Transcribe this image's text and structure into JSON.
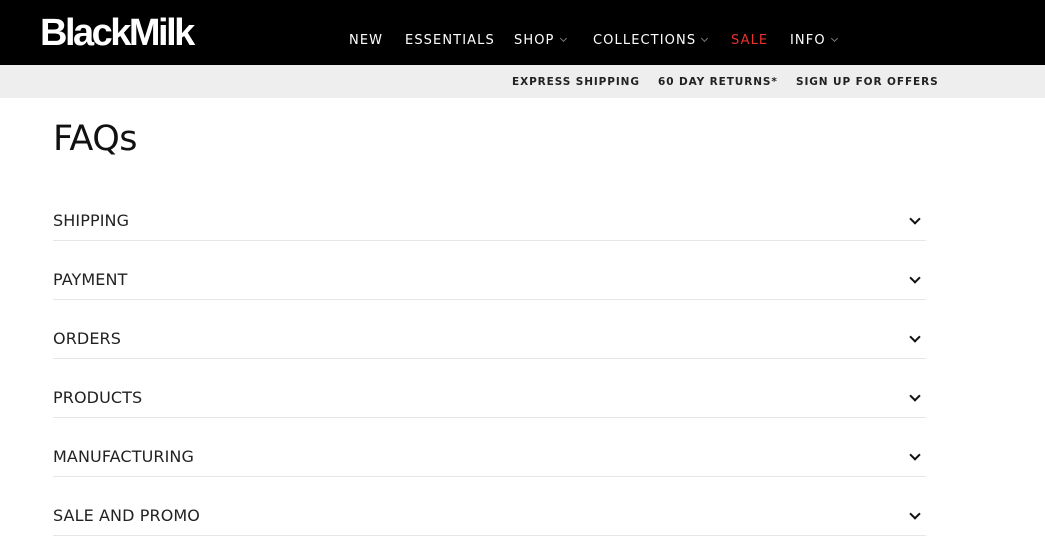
{
  "header": {
    "logo_text": "BlackMilk",
    "nav": {
      "new": "NEW",
      "essentials": "ESSENTIALS",
      "shop": "SHOP",
      "collections": "COLLECTIONS",
      "sale": "SALE",
      "info": "INFO"
    },
    "colors": {
      "background": "#000000",
      "text": "#ffffff",
      "sale": "#e8322e"
    }
  },
  "promo_bar": {
    "express_shipping": "EXPRESS SHIPPING",
    "returns": "60 DAY RETURNS*",
    "offers": "SIGN UP FOR OFFERS"
  },
  "main": {
    "title": "FAQs",
    "faq_sections": [
      {
        "label": "SHIPPING",
        "icon": "chevron-down-icon"
      },
      {
        "label": "PAYMENT",
        "icon": "chevron-down-icon"
      },
      {
        "label": "ORDERS",
        "icon": "chevron-down-icon"
      },
      {
        "label": "PRODUCTS",
        "icon": "chevron-down-icon"
      },
      {
        "label": "MANUFACTURING",
        "icon": "chevron-down-icon"
      },
      {
        "label": "SALE AND PROMO",
        "icon": "chevron-down-icon"
      }
    ]
  }
}
